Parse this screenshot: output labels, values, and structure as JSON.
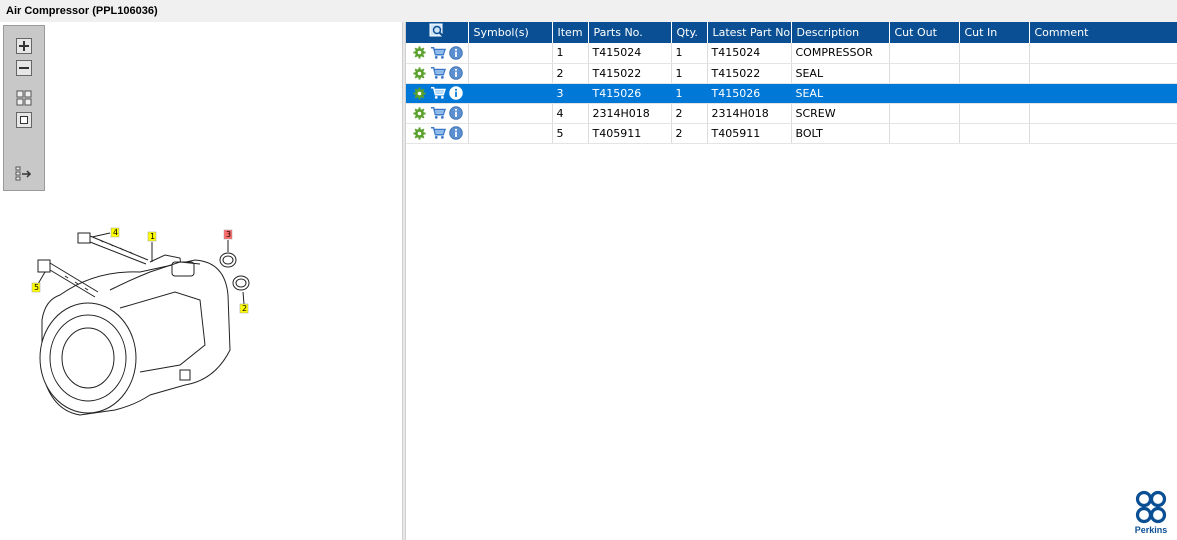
{
  "window": {
    "title": "Air Compressor (PPL106036)"
  },
  "viewer": {
    "tools": [
      "zoom-in-icon",
      "zoom-out-icon",
      "fit-page-icon",
      "actual-size-icon",
      "export-panel-icon"
    ],
    "callouts": [
      {
        "label": "1",
        "highlighted": false
      },
      {
        "label": "2",
        "highlighted": false
      },
      {
        "label": "3",
        "highlighted": true
      },
      {
        "label": "4",
        "highlighted": false
      },
      {
        "label": "5",
        "highlighted": false
      }
    ],
    "callout_color": "#ffff00",
    "callout_highlight_color": "#ff6b6b"
  },
  "table": {
    "header_color": "#0a4f93",
    "selected_color": "#0078d7",
    "columns": {
      "symbols": "Symbol(s)",
      "item": "Item",
      "parts_no": "Parts No.",
      "qty": "Qty.",
      "latest_part_no": "Latest Part No.",
      "description": "Description",
      "cut_out": "Cut Out",
      "cut_in": "Cut In",
      "comment": "Comment"
    },
    "rows": [
      {
        "item": "1",
        "parts_no": "T415024",
        "qty": "1",
        "latest_part_no": "T415024",
        "description": "COMPRESSOR",
        "cut_out": "",
        "cut_in": "",
        "comment": ""
      },
      {
        "item": "2",
        "parts_no": "T415022",
        "qty": "1",
        "latest_part_no": "T415022",
        "description": "SEAL",
        "cut_out": "",
        "cut_in": "",
        "comment": ""
      },
      {
        "item": "3",
        "parts_no": "T415026",
        "qty": "1",
        "latest_part_no": "T415026",
        "description": "SEAL",
        "cut_out": "",
        "cut_in": "",
        "comment": ""
      },
      {
        "item": "4",
        "parts_no": "2314H018",
        "qty": "2",
        "latest_part_no": "2314H018",
        "description": "SCREW",
        "cut_out": "",
        "cut_in": "",
        "comment": ""
      },
      {
        "item": "5",
        "parts_no": "T405911",
        "qty": "2",
        "latest_part_no": "T405911",
        "description": "BOLT",
        "cut_out": "",
        "cut_in": "",
        "comment": ""
      }
    ],
    "selected_item": "3"
  },
  "brand": {
    "name": "Perkins",
    "color": "#0a4f93"
  }
}
